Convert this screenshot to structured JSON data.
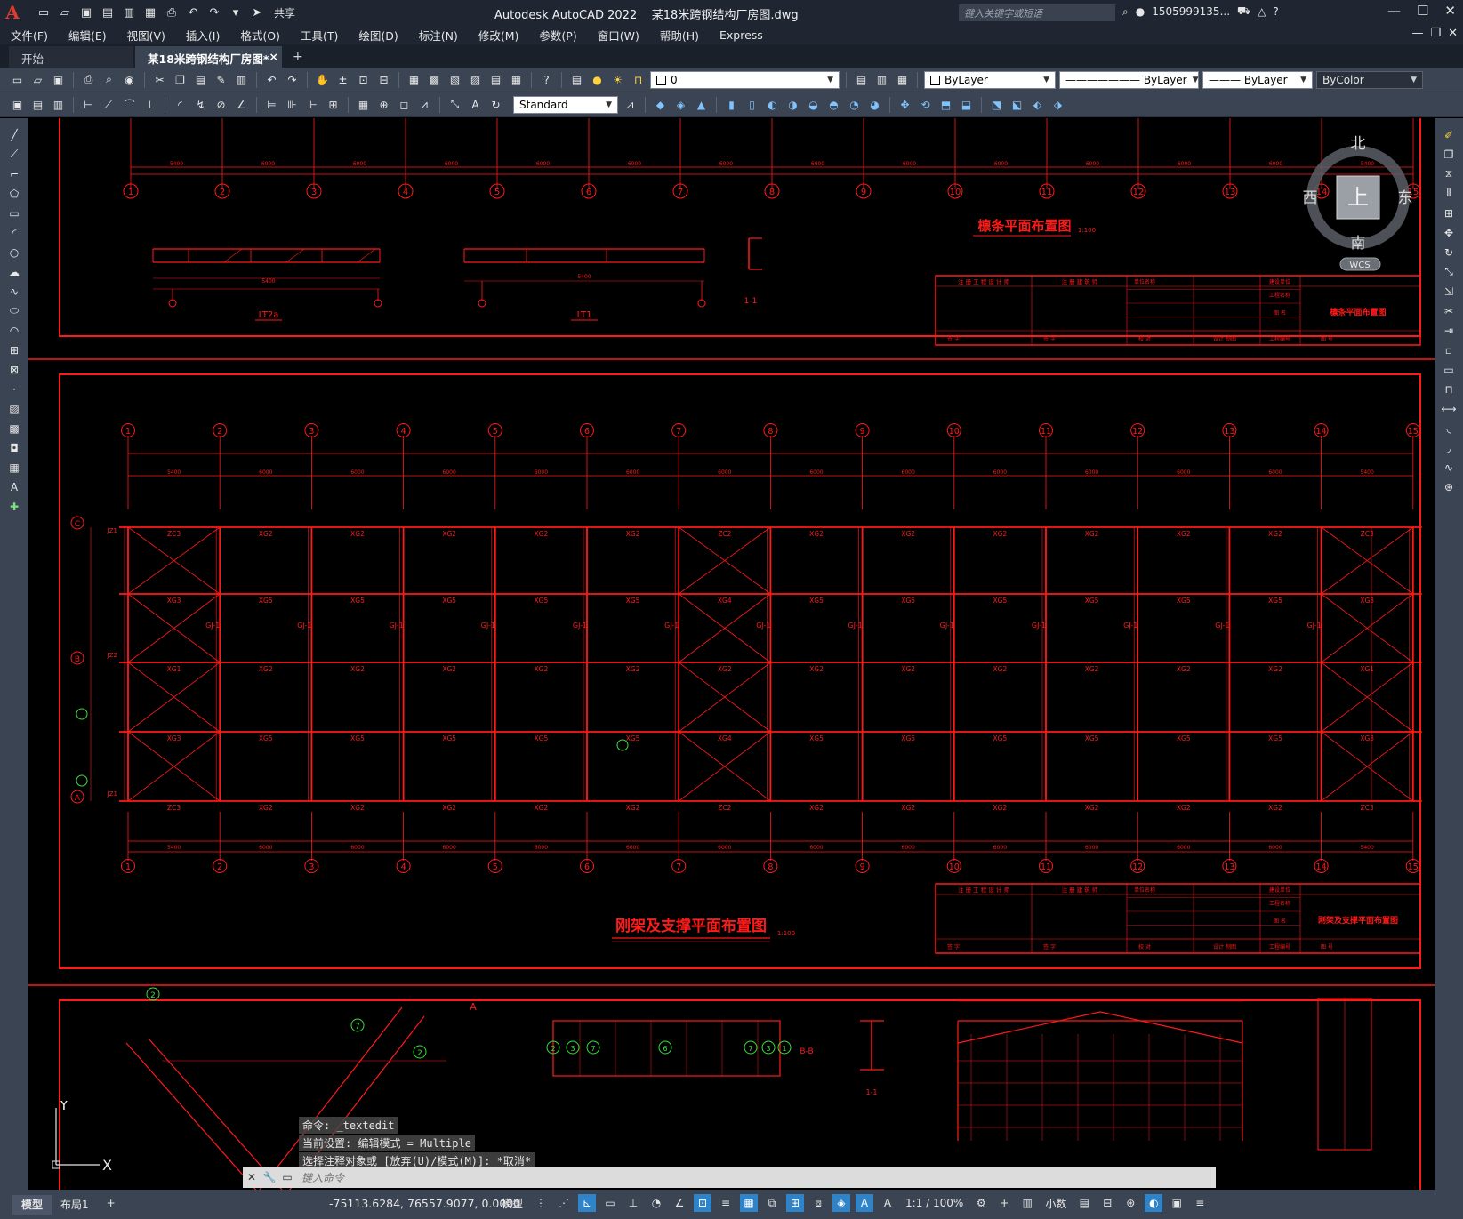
{
  "app": {
    "logo": "A",
    "title": "Autodesk AutoCAD 2022",
    "document": "某18米跨钢结构厂房图.dwg",
    "share_label": "共享",
    "search_placeholder": "键入关键字或短语",
    "user": "1505999135...",
    "colors": {
      "titlebar": "#1f2632",
      "toolbar": "#3b4453",
      "drawing_red": "#ff1a1a",
      "accent": "#2f83c9"
    }
  },
  "menu": [
    "文件(F)",
    "编辑(E)",
    "视图(V)",
    "插入(I)",
    "格式(O)",
    "工具(T)",
    "绘图(D)",
    "标注(N)",
    "修改(M)",
    "参数(P)",
    "窗口(W)",
    "帮助(H)",
    "Express"
  ],
  "tabs": {
    "start": "开始",
    "active": "某18米跨钢结构厂房图*",
    "close": "×",
    "add": "+"
  },
  "toolbars": {
    "layer_value": "0",
    "color_value": "ByLayer",
    "linetype_value": "ByLayer",
    "lineweight_value": "ByLayer",
    "plotstyle_value": "ByColor",
    "textstyle_value": "Standard"
  },
  "viewcube": {
    "north": "北",
    "south": "南",
    "east": "东",
    "west": "西",
    "top": "上",
    "wcs": "WCS"
  },
  "drawing": {
    "axes": [
      "1",
      "2",
      "3",
      "4",
      "5",
      "6",
      "7",
      "8",
      "9",
      "10",
      "11",
      "12",
      "13",
      "14",
      "15"
    ],
    "rows": [
      "C",
      "B",
      "A"
    ],
    "title_top": "檩条平面布置图",
    "title_top_scale": "1:100",
    "title_main": "刚架及支撑平面布置图",
    "title_main_scale": "1:100",
    "sheet_top": "檩条平面布置图",
    "sheet_main": "刚架及支撑平面布置图",
    "detail_labels": [
      "LT2a",
      "LT1",
      "1-1",
      "1-1",
      "B-B",
      "A"
    ],
    "titleblock_headers": [
      "注 册 工 程 设 计 师",
      "注 册 建 筑 师",
      "单位名称",
      "建设单位",
      "工程名称",
      "图 名",
      "签 字",
      "签 字",
      "校 对",
      "设计 制图",
      "工程编号",
      "图 号"
    ],
    "grid_dims": [
      "5400",
      "6000",
      "6000",
      "6000",
      "6000",
      "6000",
      "6000",
      "6000",
      "6000",
      "6000",
      "6000",
      "6000",
      "6000",
      "5400"
    ],
    "bays": {
      "row1": [
        "ZC3",
        "XG2",
        "XG2",
        "XG2",
        "XG2",
        "XG2",
        "ZC2",
        "XG2",
        "XG2",
        "XG2",
        "XG2",
        "XG2",
        "XG2",
        "ZC3"
      ],
      "row2": [
        "XG3",
        "XG5",
        "XG5",
        "XG5",
        "XG5",
        "XG5",
        "XG4",
        "XG5",
        "XG5",
        "XG5",
        "XG5",
        "XG5",
        "XG5",
        "XG3"
      ],
      "row3": [
        "XG1",
        "XG2",
        "XG2",
        "XG2",
        "XG2",
        "XG2",
        "XG2",
        "XG2",
        "XG2",
        "XG2",
        "XG2",
        "XG2",
        "XG2",
        "XG1"
      ],
      "row4": [
        "XG3",
        "XG5",
        "XG5",
        "XG5",
        "XG5",
        "XG5",
        "XG4",
        "XG5",
        "XG5",
        "XG5",
        "XG5",
        "XG5",
        "XG5",
        "XG3"
      ],
      "row5": [
        "ZC3",
        "XG2",
        "XG2",
        "XG2",
        "XG2",
        "XG2",
        "ZC2",
        "XG2",
        "XG2",
        "XG2",
        "XG2",
        "XG2",
        "XG2",
        "ZC3"
      ]
    },
    "frame_label": "GJ-1",
    "column_labels": [
      "JZ1",
      "JZ2",
      "JZ1"
    ]
  },
  "command": {
    "history": [
      "命令: _textedit",
      "当前设置: 编辑模式 = Multiple",
      "选择注释对象或 [放弃(U)/模式(M)]: *取消*"
    ],
    "placeholder": "键入命令"
  },
  "status": {
    "layouts": [
      "模型",
      "布局1"
    ],
    "coords": "-75113.6284, 76557.9077, 0.0000",
    "mode": "模型",
    "scale": "1:1 / 100%",
    "units": "小数"
  }
}
